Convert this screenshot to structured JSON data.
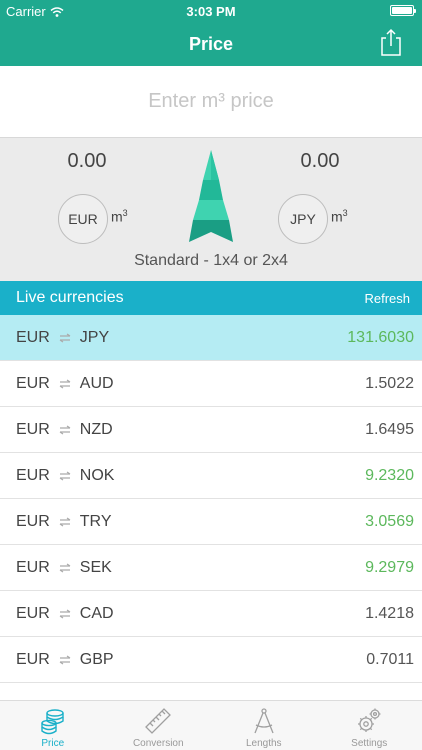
{
  "status_bar": {
    "carrier": "Carrier",
    "time": "3:03 PM"
  },
  "nav": {
    "title": "Price"
  },
  "price_input": {
    "placeholder": "Enter m³ price",
    "value": ""
  },
  "converter": {
    "from_amount": "0.00",
    "to_amount": "0.00",
    "from_currency": "EUR",
    "to_currency": "JPY",
    "unit": "m",
    "unit_power": "3",
    "wood_type": "Standard - 1x4 or 2x4"
  },
  "live": {
    "title": "Live currencies",
    "refresh_label": "Refresh"
  },
  "currencies": [
    {
      "from": "EUR",
      "to": "JPY",
      "rate": "131.6030",
      "trend": "up",
      "selected": true
    },
    {
      "from": "EUR",
      "to": "AUD",
      "rate": "1.5022",
      "trend": "down",
      "selected": false
    },
    {
      "from": "EUR",
      "to": "NZD",
      "rate": "1.6495",
      "trend": "down",
      "selected": false
    },
    {
      "from": "EUR",
      "to": "NOK",
      "rate": "9.2320",
      "trend": "up",
      "selected": false
    },
    {
      "from": "EUR",
      "to": "TRY",
      "rate": "3.0569",
      "trend": "up",
      "selected": false
    },
    {
      "from": "EUR",
      "to": "SEK",
      "rate": "9.2979",
      "trend": "up",
      "selected": false
    },
    {
      "from": "EUR",
      "to": "CAD",
      "rate": "1.4218",
      "trend": "down",
      "selected": false
    },
    {
      "from": "EUR",
      "to": "GBP",
      "rate": "0.7011",
      "trend": "down",
      "selected": false
    }
  ],
  "tabs": [
    {
      "label": "Price",
      "icon": "coins-icon",
      "active": true
    },
    {
      "label": "Conversion",
      "icon": "ruler-icon",
      "active": false
    },
    {
      "label": "Lengths",
      "icon": "compass-icon",
      "active": false
    },
    {
      "label": "Settings",
      "icon": "gears-icon",
      "active": false
    }
  ],
  "colors": {
    "header": "#1fa98f",
    "live_bar": "#1ab0c9",
    "selected_row": "#b5ecf3",
    "rate_up": "#5cb85c",
    "rate_down": "#555555",
    "tab_active": "#1ab0c9"
  }
}
